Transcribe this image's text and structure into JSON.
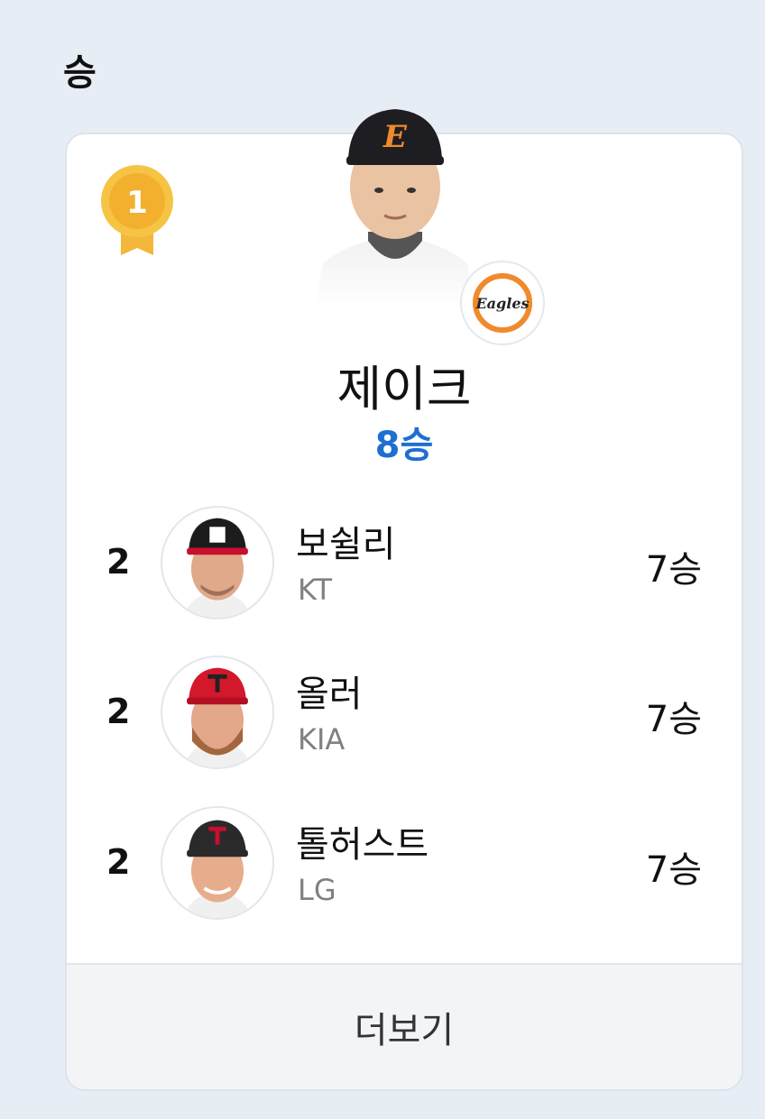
{
  "section": {
    "title": "승"
  },
  "leader": {
    "rank": "1",
    "name": "제이크",
    "stat": "8승",
    "team_logo_text": "Eagles",
    "cap_letter": "E"
  },
  "others": [
    {
      "rank": "2",
      "name": "보쉴리",
      "team": "KT",
      "stat": "7승"
    },
    {
      "rank": "2",
      "name": "올러",
      "team": "KIA",
      "stat": "7승"
    },
    {
      "rank": "2",
      "name": "톨허스트",
      "team": "LG",
      "stat": "7승"
    }
  ],
  "more_button": {
    "label": "더보기"
  },
  "colors": {
    "accent": "#1e6fd0",
    "background": "#e7edf4"
  },
  "icons": {
    "medal": "gold-medal-icon"
  }
}
